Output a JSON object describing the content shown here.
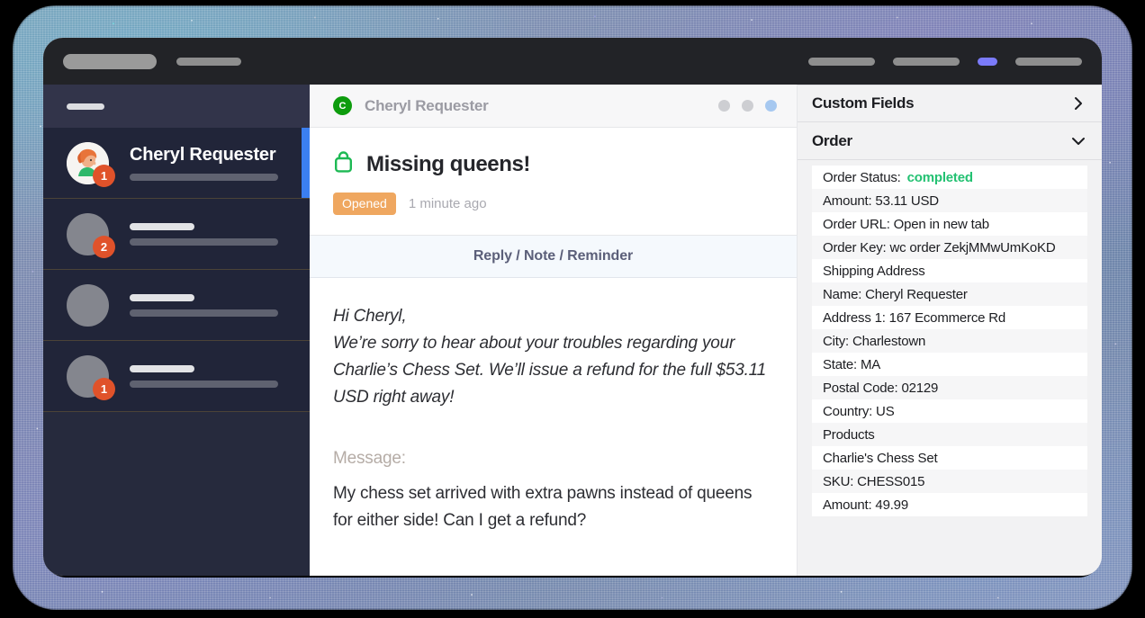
{
  "topnav": {
    "logo": "logo-placeholder",
    "left_items": [
      "nav-placeholder-1"
    ],
    "right_items": [
      "nav-placeholder-2",
      "nav-placeholder-3",
      "nav-placeholder-accent",
      "nav-placeholder-4"
    ],
    "accent_color": "#7b7bfa"
  },
  "sidebar": {
    "background": "#262a3d",
    "header_placeholder": "search-placeholder",
    "active_indicator_color": "#3b7ff0",
    "badge_color": "#e0522a",
    "conversations": [
      {
        "name": "Cheryl Requester",
        "badge": "1",
        "active": true,
        "avatar": "illustrated-avatar"
      },
      {
        "name": "",
        "badge": "2",
        "active": false,
        "avatar": "placeholder-avatar"
      },
      {
        "name": "",
        "badge": "",
        "active": false,
        "avatar": "placeholder-avatar"
      },
      {
        "name": "",
        "badge": "1",
        "active": false,
        "avatar": "placeholder-avatar"
      }
    ]
  },
  "conversation": {
    "header": {
      "avatar_initial": "C",
      "avatar_color": "#0d9c0d",
      "requester_name": "Cheryl Requester",
      "dots": [
        "gray",
        "gray",
        "blue"
      ]
    },
    "ticket": {
      "icon": "shopping-bag-icon",
      "icon_color": "#1db954",
      "title": "Missing queens!",
      "status": "Opened",
      "status_color": "#efa760",
      "timestamp": "1 minute ago"
    },
    "action_bar": {
      "label": "Reply / Note / Reminder"
    },
    "reply": {
      "lines": [
        "Hi Cheryl,",
        "We’re sorry to hear about your troubles regarding your Charlie’s Chess Set. We’ll issue a refund for the full $53.11 USD right away!"
      ]
    },
    "message": {
      "label": "Message:",
      "body": "My chess set arrived with extra pawns instead of queens for either side! Can I get a refund?"
    }
  },
  "right_panel": {
    "sections": [
      {
        "title": "Custom Fields",
        "expanded": false,
        "chevron": "chevron-right-icon"
      },
      {
        "title": "Order",
        "expanded": true,
        "chevron": "chevron-down-icon"
      }
    ],
    "order_fields": [
      {
        "label": "Order Status:",
        "value": "completed",
        "highlight": true
      },
      {
        "label": "Amount: 53.11 USD",
        "value": "",
        "highlight": false
      },
      {
        "label": "Order URL: Open in new tab",
        "value": "",
        "highlight": false
      },
      {
        "label": "Order Key: wc order ZekjMMwUmKoKD",
        "value": "",
        "highlight": false
      },
      {
        "label": "Shipping Address",
        "value": "",
        "highlight": false
      },
      {
        "label": "Name: Cheryl Requester",
        "value": "",
        "highlight": false
      },
      {
        "label": "Address 1: 167 Ecommerce Rd",
        "value": "",
        "highlight": false
      },
      {
        "label": "City: Charlestown",
        "value": "",
        "highlight": false
      },
      {
        "label": "State: MA",
        "value": "",
        "highlight": false
      },
      {
        "label": "Postal Code: 02129",
        "value": "",
        "highlight": false
      },
      {
        "label": "Country: US",
        "value": "",
        "highlight": false
      },
      {
        "label": "Products",
        "value": "",
        "highlight": false
      },
      {
        "label": "Charlie's Chess Set",
        "value": "",
        "highlight": false
      },
      {
        "label": "SKU: CHESS015",
        "value": "",
        "highlight": false
      },
      {
        "label": "Amount: 49.99",
        "value": "",
        "highlight": false
      }
    ]
  }
}
